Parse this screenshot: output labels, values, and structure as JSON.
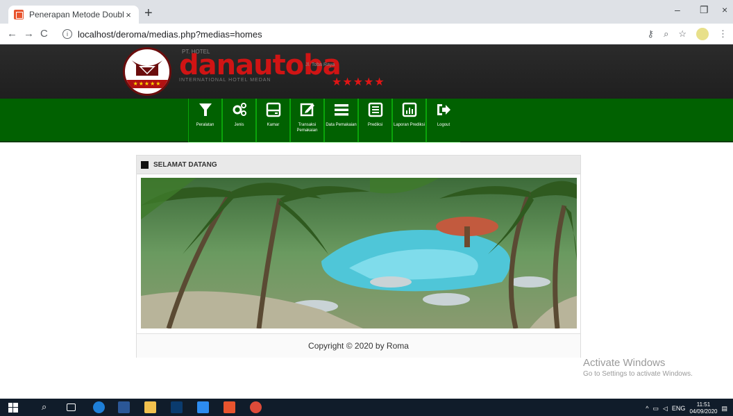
{
  "browser": {
    "tab_title": "Penerapan Metode Double Expo",
    "tab_close": "×",
    "new_tab": "+",
    "url": "localhost/deroma/medias.php?medias=homes",
    "info_icon": "i",
    "win_min": "–",
    "win_max": "❐",
    "win_close": "×"
  },
  "header": {
    "brand_top_left": "PT. HOTEL",
    "brand": "danautoba",
    "brand_right": "Jl. Toba Raya",
    "brand_sub": "INTERNATIONAL HOTEL MEDAN",
    "stars": "★★★★★",
    "logo_stars": "★★★★★"
  },
  "nav": {
    "items": [
      {
        "label": "Peralatan",
        "icon": "filter-icon"
      },
      {
        "label": "Jenis",
        "icon": "gears-icon"
      },
      {
        "label": "Kamar",
        "icon": "hdd-icon"
      },
      {
        "label": "Transaksi Pemakaian",
        "icon": "edit-icon"
      },
      {
        "label": "Data Pemakaian",
        "icon": "bars-icon"
      },
      {
        "label": "Prediksi",
        "icon": "list-icon"
      },
      {
        "label": "Laporan Prediksi",
        "icon": "chart-icon"
      },
      {
        "label": "Logout",
        "icon": "logout-icon"
      }
    ]
  },
  "panel": {
    "title": "SELAMAT DATANG",
    "footer": "Copyright © 2020 by Roma"
  },
  "watermark": {
    "line1": "Activate Windows",
    "line2": "Go to Settings to activate Windows."
  },
  "taskbar": {
    "lang": "ENG",
    "time": "11:51",
    "date": "04/09/2020"
  }
}
